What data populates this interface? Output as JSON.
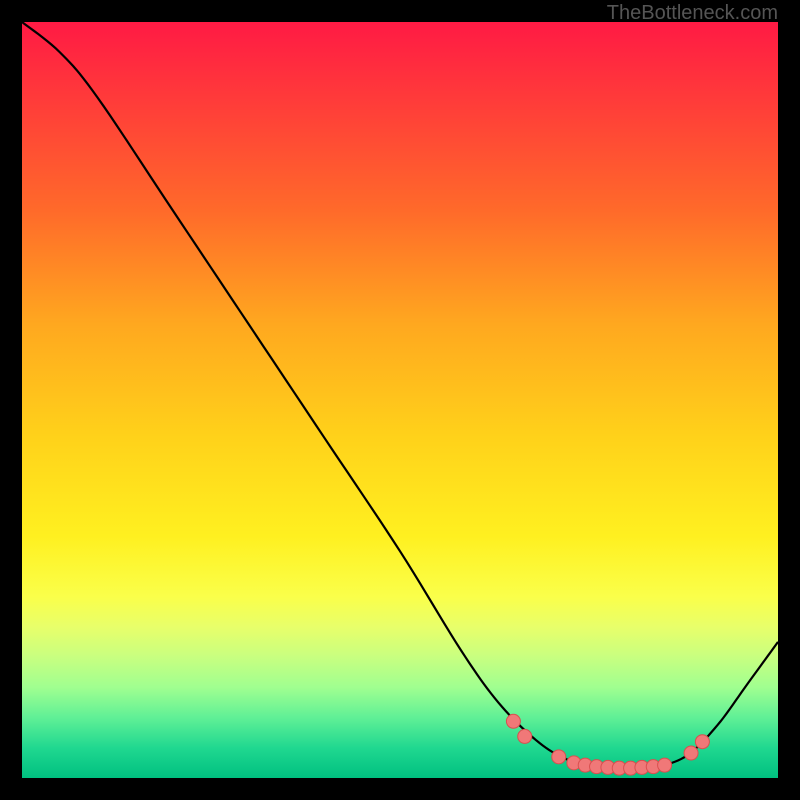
{
  "attribution": "TheBottleneck.com",
  "chart_data": {
    "type": "line",
    "title": "",
    "xlabel": "",
    "ylabel": "",
    "xlim": [
      0,
      100
    ],
    "ylim": [
      0,
      100
    ],
    "curve": [
      {
        "x": 0.0,
        "y": 100.0
      },
      {
        "x": 5.0,
        "y": 96.0
      },
      {
        "x": 10.0,
        "y": 90.0
      },
      {
        "x": 20.0,
        "y": 75.0
      },
      {
        "x": 30.0,
        "y": 60.0
      },
      {
        "x": 40.0,
        "y": 45.0
      },
      {
        "x": 50.0,
        "y": 30.0
      },
      {
        "x": 58.0,
        "y": 17.0
      },
      {
        "x": 63.0,
        "y": 10.0
      },
      {
        "x": 68.0,
        "y": 5.0
      },
      {
        "x": 72.0,
        "y": 2.5
      },
      {
        "x": 76.0,
        "y": 1.5
      },
      {
        "x": 80.0,
        "y": 1.2
      },
      {
        "x": 84.0,
        "y": 1.5
      },
      {
        "x": 88.0,
        "y": 3.0
      },
      {
        "x": 92.0,
        "y": 7.0
      },
      {
        "x": 96.0,
        "y": 12.5
      },
      {
        "x": 100.0,
        "y": 18.0
      }
    ],
    "marker_points": [
      {
        "x": 65.0,
        "y": 7.5
      },
      {
        "x": 66.5,
        "y": 5.5
      },
      {
        "x": 71.0,
        "y": 2.8
      },
      {
        "x": 73.0,
        "y": 2.0
      },
      {
        "x": 74.5,
        "y": 1.7
      },
      {
        "x": 76.0,
        "y": 1.5
      },
      {
        "x": 77.5,
        "y": 1.4
      },
      {
        "x": 79.0,
        "y": 1.3
      },
      {
        "x": 80.5,
        "y": 1.3
      },
      {
        "x": 82.0,
        "y": 1.4
      },
      {
        "x": 83.5,
        "y": 1.5
      },
      {
        "x": 85.0,
        "y": 1.7
      },
      {
        "x": 88.5,
        "y": 3.3
      },
      {
        "x": 90.0,
        "y": 4.8
      }
    ],
    "colors": {
      "curve": "#000000",
      "marker_fill": "#f07878",
      "marker_stroke": "#d85050"
    }
  }
}
